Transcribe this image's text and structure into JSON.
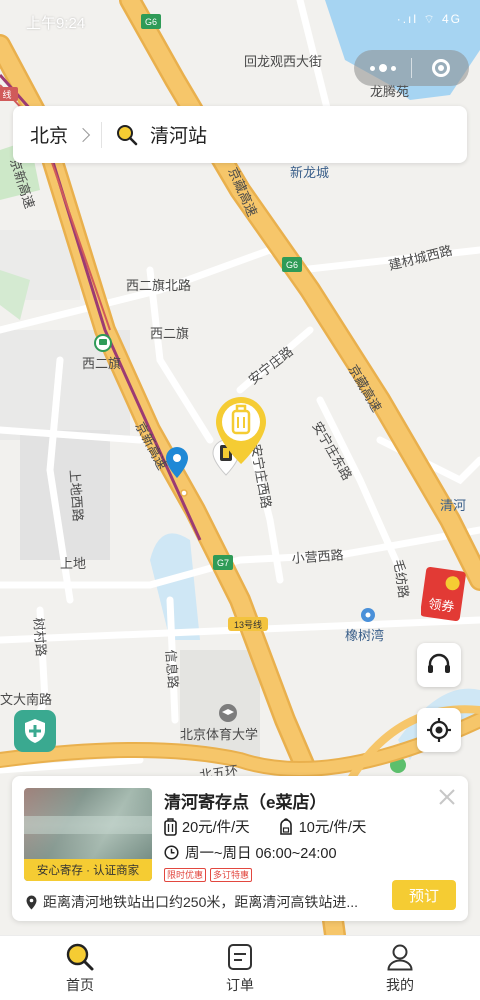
{
  "status": {
    "time": "上午9:24",
    "indicators": "·.ıl  ⌔  4G"
  },
  "search": {
    "city": "北京",
    "query": "清河站"
  },
  "map": {
    "labels": {
      "g6_top": "G6",
      "g6_mid": "G6",
      "g7": "G7",
      "line13": "13号线",
      "line_edge": "线",
      "huilongguan": "回龙观西大街",
      "longtengyuan": "龙腾苑",
      "xinlongcheng": "新龙城",
      "jingxin_top": "京新高速",
      "jingzang_top": "京藏高速",
      "xierqi_north": "西二旗北路",
      "jiancai": "建材城西路",
      "xierqi_area": "西二旗",
      "xierqi_station": "西二旗",
      "anning": "安宁庄路",
      "jingzang": "京藏高速",
      "anningzhuang_east": "安宁庄东路",
      "jingxin_mid": "京新高速",
      "anningzhuang_west": "安宁庄西路",
      "qinghe": "清河",
      "shangdi_west": "上地西路",
      "shangdi": "上地",
      "xiaoying": "小营西路",
      "maofang": "毛纺路",
      "shulin": "树村路",
      "xinxi": "信息路",
      "xiangshuwan": "橡树湾",
      "sports_univ": "北京体育大学",
      "wenda": "文大南路",
      "north5": "北五环"
    }
  },
  "coupon": {
    "label": "领券"
  },
  "card": {
    "title": "清河寄存点（e菜店）",
    "badge": "安心寄存 · 认证商家",
    "price_large": "20元/件/天",
    "price_small": "10元/件/天",
    "hours": "周一~周日 06:00~24:00",
    "tags": [
      "限时优惠",
      "多订特惠"
    ],
    "address": "距离清河地铁站出口约250米，距离清河高铁站进...",
    "book_label": "预订"
  },
  "tabs": [
    {
      "label": "首页",
      "icon": "search-icon",
      "active": true
    },
    {
      "label": "订单",
      "icon": "order-icon",
      "active": false
    },
    {
      "label": "我的",
      "icon": "user-icon",
      "active": false
    }
  ],
  "colors": {
    "accent": "#f5cc33",
    "highway": "#f6c66a",
    "water": "#a6d4f2",
    "green": "#3aa990"
  }
}
